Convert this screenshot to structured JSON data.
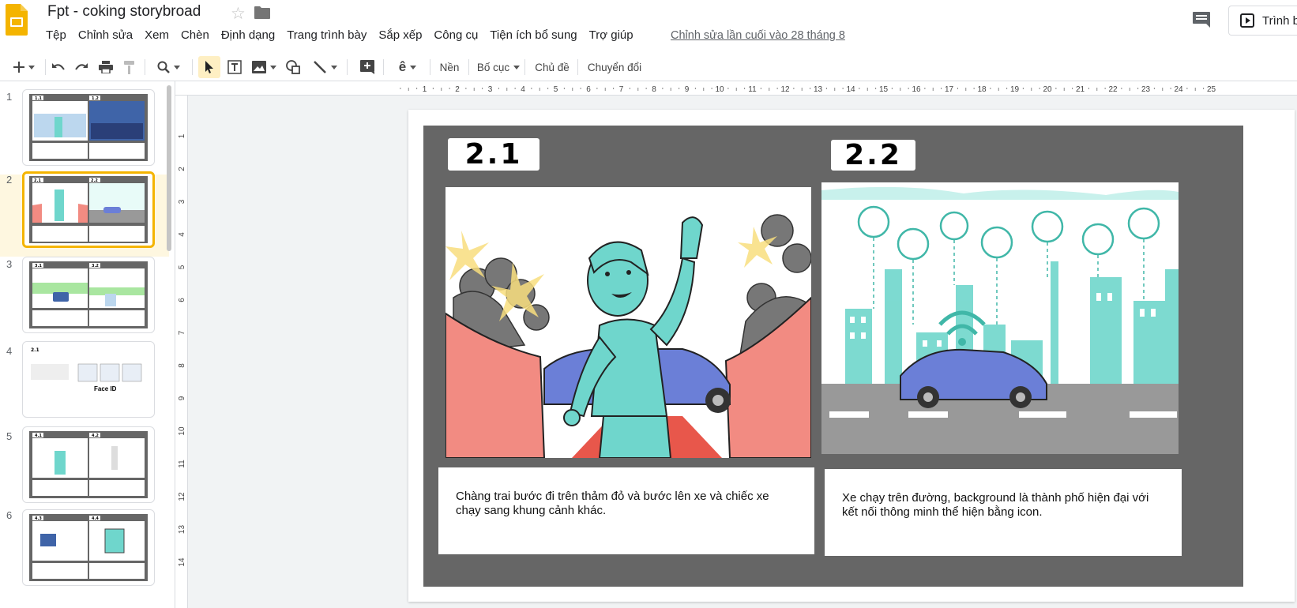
{
  "app": {
    "doc_title": "Fpt - coking storybroad",
    "last_edit": "Chỉnh sửa lần cuối vào 28 tháng 8",
    "present_label": "Trình b",
    "icons": [
      "slides-logo-icon",
      "star-icon",
      "folder-icon",
      "comment-icon",
      "present-icon"
    ]
  },
  "menu": [
    "Tệp",
    "Chỉnh sửa",
    "Xem",
    "Chèn",
    "Định dạng",
    "Trang trình bày",
    "Sắp xếp",
    "Công cụ",
    "Tiện ích bổ sung",
    "Trợ giúp"
  ],
  "toolbar": {
    "background": "Nền",
    "layout": "Bố cục",
    "theme": "Chủ đề",
    "transition": "Chuyển đổi"
  },
  "ruler": {
    "horizontal": [
      "1",
      "2",
      "3",
      "4",
      "5",
      "6",
      "7",
      "8",
      "9",
      "10",
      "11",
      "12",
      "13",
      "14",
      "15",
      "16",
      "17",
      "18",
      "19",
      "20",
      "21",
      "22",
      "23",
      "24",
      "25"
    ],
    "vertical": [
      "1",
      "2",
      "3",
      "4",
      "5",
      "6",
      "7",
      "8",
      "9",
      "10",
      "11",
      "12",
      "13",
      "14"
    ]
  },
  "filmstrip": {
    "selected": 2,
    "slides": [
      {
        "num": "1",
        "labels": [
          "1.1",
          "1.2"
        ]
      },
      {
        "num": "2",
        "labels": [
          "2.1",
          "2.2"
        ]
      },
      {
        "num": "3",
        "labels": [
          "3.1",
          "3.2"
        ]
      },
      {
        "num": "4",
        "labels": [
          "2.1"
        ],
        "caption": "Face ID"
      },
      {
        "num": "5",
        "labels": [
          "4.1",
          "4.2"
        ]
      },
      {
        "num": "6",
        "labels": [
          "4.3",
          "4.4"
        ]
      }
    ]
  },
  "slide": {
    "panel_left_label": "2.1",
    "panel_right_label": "2.2",
    "caption_left": "Chàng trai bước đi trên thảm đỏ và bước lên xe và chiếc xe chạy sang khung cảnh khác.",
    "caption_right": "Xe chạy trên đường, background là thành phố hiện đại với kết nối thông minh thể hiện bằng icon."
  },
  "colors": {
    "accent_yellow": "#f4b400",
    "board_gray": "#666666",
    "teal": "#6fd6cc",
    "curtain_red": "#f28b82",
    "car_blue": "#6b7fd7"
  }
}
